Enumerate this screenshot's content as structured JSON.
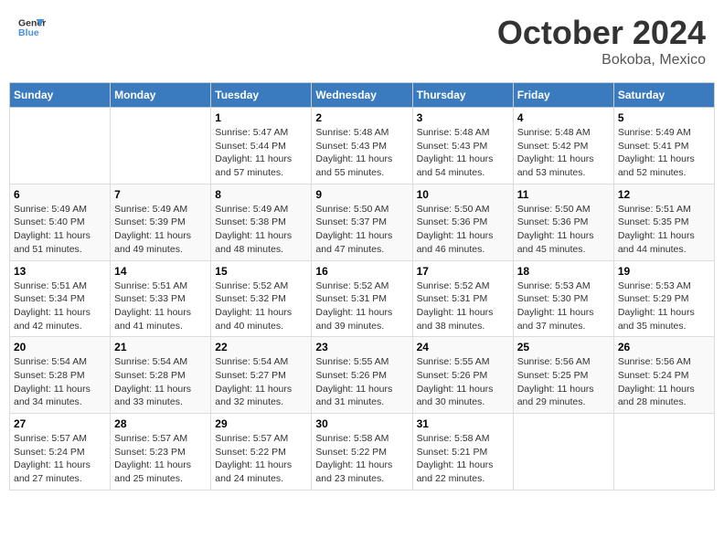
{
  "header": {
    "logo_line1": "General",
    "logo_line2": "Blue",
    "month": "October 2024",
    "location": "Bokoba, Mexico"
  },
  "days_of_week": [
    "Sunday",
    "Monday",
    "Tuesday",
    "Wednesday",
    "Thursday",
    "Friday",
    "Saturday"
  ],
  "weeks": [
    [
      {
        "day": "",
        "sunrise": "",
        "sunset": "",
        "daylight": ""
      },
      {
        "day": "",
        "sunrise": "",
        "sunset": "",
        "daylight": ""
      },
      {
        "day": "1",
        "sunrise": "Sunrise: 5:47 AM",
        "sunset": "Sunset: 5:44 PM",
        "daylight": "Daylight: 11 hours and 57 minutes."
      },
      {
        "day": "2",
        "sunrise": "Sunrise: 5:48 AM",
        "sunset": "Sunset: 5:43 PM",
        "daylight": "Daylight: 11 hours and 55 minutes."
      },
      {
        "day": "3",
        "sunrise": "Sunrise: 5:48 AM",
        "sunset": "Sunset: 5:43 PM",
        "daylight": "Daylight: 11 hours and 54 minutes."
      },
      {
        "day": "4",
        "sunrise": "Sunrise: 5:48 AM",
        "sunset": "Sunset: 5:42 PM",
        "daylight": "Daylight: 11 hours and 53 minutes."
      },
      {
        "day": "5",
        "sunrise": "Sunrise: 5:49 AM",
        "sunset": "Sunset: 5:41 PM",
        "daylight": "Daylight: 11 hours and 52 minutes."
      }
    ],
    [
      {
        "day": "6",
        "sunrise": "Sunrise: 5:49 AM",
        "sunset": "Sunset: 5:40 PM",
        "daylight": "Daylight: 11 hours and 51 minutes."
      },
      {
        "day": "7",
        "sunrise": "Sunrise: 5:49 AM",
        "sunset": "Sunset: 5:39 PM",
        "daylight": "Daylight: 11 hours and 49 minutes."
      },
      {
        "day": "8",
        "sunrise": "Sunrise: 5:49 AM",
        "sunset": "Sunset: 5:38 PM",
        "daylight": "Daylight: 11 hours and 48 minutes."
      },
      {
        "day": "9",
        "sunrise": "Sunrise: 5:50 AM",
        "sunset": "Sunset: 5:37 PM",
        "daylight": "Daylight: 11 hours and 47 minutes."
      },
      {
        "day": "10",
        "sunrise": "Sunrise: 5:50 AM",
        "sunset": "Sunset: 5:36 PM",
        "daylight": "Daylight: 11 hours and 46 minutes."
      },
      {
        "day": "11",
        "sunrise": "Sunrise: 5:50 AM",
        "sunset": "Sunset: 5:36 PM",
        "daylight": "Daylight: 11 hours and 45 minutes."
      },
      {
        "day": "12",
        "sunrise": "Sunrise: 5:51 AM",
        "sunset": "Sunset: 5:35 PM",
        "daylight": "Daylight: 11 hours and 44 minutes."
      }
    ],
    [
      {
        "day": "13",
        "sunrise": "Sunrise: 5:51 AM",
        "sunset": "Sunset: 5:34 PM",
        "daylight": "Daylight: 11 hours and 42 minutes."
      },
      {
        "day": "14",
        "sunrise": "Sunrise: 5:51 AM",
        "sunset": "Sunset: 5:33 PM",
        "daylight": "Daylight: 11 hours and 41 minutes."
      },
      {
        "day": "15",
        "sunrise": "Sunrise: 5:52 AM",
        "sunset": "Sunset: 5:32 PM",
        "daylight": "Daylight: 11 hours and 40 minutes."
      },
      {
        "day": "16",
        "sunrise": "Sunrise: 5:52 AM",
        "sunset": "Sunset: 5:31 PM",
        "daylight": "Daylight: 11 hours and 39 minutes."
      },
      {
        "day": "17",
        "sunrise": "Sunrise: 5:52 AM",
        "sunset": "Sunset: 5:31 PM",
        "daylight": "Daylight: 11 hours and 38 minutes."
      },
      {
        "day": "18",
        "sunrise": "Sunrise: 5:53 AM",
        "sunset": "Sunset: 5:30 PM",
        "daylight": "Daylight: 11 hours and 37 minutes."
      },
      {
        "day": "19",
        "sunrise": "Sunrise: 5:53 AM",
        "sunset": "Sunset: 5:29 PM",
        "daylight": "Daylight: 11 hours and 35 minutes."
      }
    ],
    [
      {
        "day": "20",
        "sunrise": "Sunrise: 5:54 AM",
        "sunset": "Sunset: 5:28 PM",
        "daylight": "Daylight: 11 hours and 34 minutes."
      },
      {
        "day": "21",
        "sunrise": "Sunrise: 5:54 AM",
        "sunset": "Sunset: 5:28 PM",
        "daylight": "Daylight: 11 hours and 33 minutes."
      },
      {
        "day": "22",
        "sunrise": "Sunrise: 5:54 AM",
        "sunset": "Sunset: 5:27 PM",
        "daylight": "Daylight: 11 hours and 32 minutes."
      },
      {
        "day": "23",
        "sunrise": "Sunrise: 5:55 AM",
        "sunset": "Sunset: 5:26 PM",
        "daylight": "Daylight: 11 hours and 31 minutes."
      },
      {
        "day": "24",
        "sunrise": "Sunrise: 5:55 AM",
        "sunset": "Sunset: 5:26 PM",
        "daylight": "Daylight: 11 hours and 30 minutes."
      },
      {
        "day": "25",
        "sunrise": "Sunrise: 5:56 AM",
        "sunset": "Sunset: 5:25 PM",
        "daylight": "Daylight: 11 hours and 29 minutes."
      },
      {
        "day": "26",
        "sunrise": "Sunrise: 5:56 AM",
        "sunset": "Sunset: 5:24 PM",
        "daylight": "Daylight: 11 hours and 28 minutes."
      }
    ],
    [
      {
        "day": "27",
        "sunrise": "Sunrise: 5:57 AM",
        "sunset": "Sunset: 5:24 PM",
        "daylight": "Daylight: 11 hours and 27 minutes."
      },
      {
        "day": "28",
        "sunrise": "Sunrise: 5:57 AM",
        "sunset": "Sunset: 5:23 PM",
        "daylight": "Daylight: 11 hours and 25 minutes."
      },
      {
        "day": "29",
        "sunrise": "Sunrise: 5:57 AM",
        "sunset": "Sunset: 5:22 PM",
        "daylight": "Daylight: 11 hours and 24 minutes."
      },
      {
        "day": "30",
        "sunrise": "Sunrise: 5:58 AM",
        "sunset": "Sunset: 5:22 PM",
        "daylight": "Daylight: 11 hours and 23 minutes."
      },
      {
        "day": "31",
        "sunrise": "Sunrise: 5:58 AM",
        "sunset": "Sunset: 5:21 PM",
        "daylight": "Daylight: 11 hours and 22 minutes."
      },
      {
        "day": "",
        "sunrise": "",
        "sunset": "",
        "daylight": ""
      },
      {
        "day": "",
        "sunrise": "",
        "sunset": "",
        "daylight": ""
      }
    ]
  ]
}
